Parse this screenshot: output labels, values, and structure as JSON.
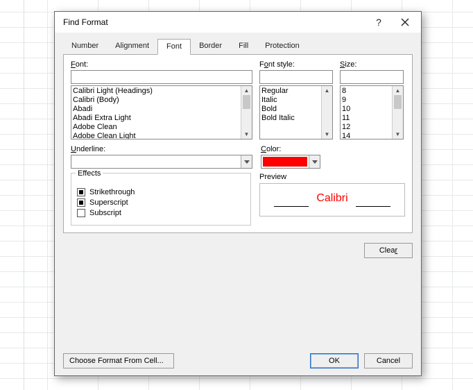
{
  "dialog": {
    "title": "Find Format",
    "help_label": "?",
    "tabs": [
      "Number",
      "Alignment",
      "Font",
      "Border",
      "Fill",
      "Protection"
    ],
    "active_tab": "Font"
  },
  "font": {
    "label_html": "Font:",
    "value": "",
    "list": [
      "Calibri Light (Headings)",
      "Calibri (Body)",
      "Abadi",
      "Abadi Extra Light",
      "Adobe Clean",
      "Adobe Clean Light"
    ]
  },
  "style": {
    "label": "Font style:",
    "value": "",
    "list": [
      "Regular",
      "Italic",
      "Bold",
      "Bold Italic"
    ]
  },
  "size": {
    "label_html": "Size:",
    "value": "",
    "list": [
      "8",
      "9",
      "10",
      "11",
      "12",
      "14"
    ]
  },
  "underline": {
    "label_html": "Underline:",
    "value": ""
  },
  "color": {
    "label_html": "Color:",
    "value_hex": "#ff0000"
  },
  "effects": {
    "legend": "Effects",
    "strike": {
      "label_html": "Strikethrough",
      "state": "indeterminate"
    },
    "super": {
      "label_html": "Superscript",
      "state": "indeterminate"
    },
    "sub": {
      "label_html": "Subscript",
      "state": "unchecked"
    }
  },
  "preview": {
    "label": "Preview",
    "text": "Calibri",
    "text_color": "#ff0000"
  },
  "buttons": {
    "clear": "Clear",
    "choose": "Choose Format From Cell...",
    "ok": "OK",
    "cancel": "Cancel"
  }
}
